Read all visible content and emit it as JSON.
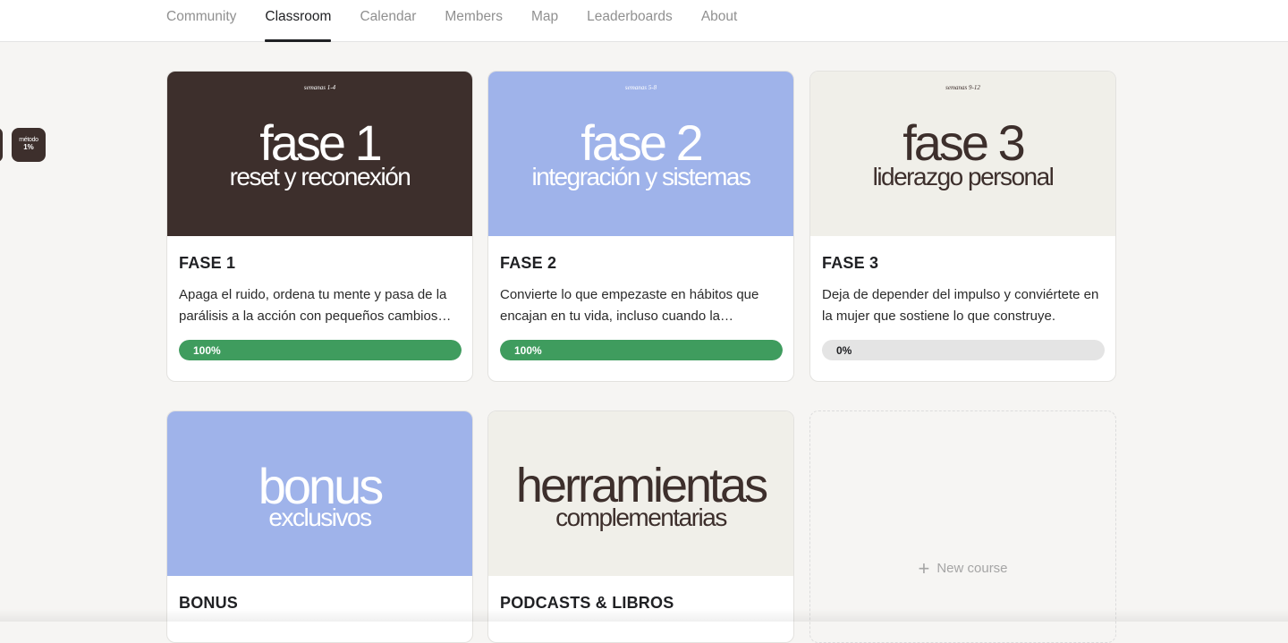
{
  "nav": {
    "tabs": [
      {
        "label": "Community",
        "active": false
      },
      {
        "label": "Classroom",
        "active": true
      },
      {
        "label": "Calendar",
        "active": false
      },
      {
        "label": "Members",
        "active": false
      },
      {
        "label": "Map",
        "active": false
      },
      {
        "label": "Leaderboards",
        "active": false
      },
      {
        "label": "About",
        "active": false
      }
    ]
  },
  "side_app": {
    "line1": "método",
    "line2": "1%"
  },
  "courses": [
    {
      "cover": {
        "weeks": "semanas 1-4",
        "big": "fase 1",
        "sub": "reset y reconexión",
        "bg": "#3d2f2c",
        "fg": "#ffffff"
      },
      "title": "FASE 1",
      "description": "Apaga el ruido, ordena tu mente y pasa de la parálisis a la acción con pequeños cambios…",
      "progress": 1.0,
      "progress_label": "100%"
    },
    {
      "cover": {
        "weeks": "semanas 5-8",
        "big": "fase 2",
        "sub": "integración y sistemas",
        "bg": "#9fb3ea",
        "fg": "#ffffff"
      },
      "title": "FASE 2",
      "description": "Convierte lo que empezaste en hábitos que encajan en tu vida, incluso cuando la…",
      "progress": 1.0,
      "progress_label": "100%"
    },
    {
      "cover": {
        "weeks": "semanas 9-12",
        "big": "fase 3",
        "sub": "liderazgo personal",
        "bg": "#f0efe9",
        "fg": "#3d2f2c"
      },
      "title": "FASE 3",
      "description": "Deja de depender del impulso y conviértete en la mujer que sostiene lo que construye.",
      "progress": 0.0,
      "progress_label": "0%"
    },
    {
      "cover": {
        "weeks": "",
        "big": "bonus",
        "sub": "exclusivos",
        "bg": "#9fb3ea",
        "fg": "#ffffff"
      },
      "title": "BONUS"
    },
    {
      "cover": {
        "weeks": "",
        "big": "herramientas",
        "sub": "complementarias",
        "bg": "#f0efe9",
        "fg": "#3d2f2c"
      },
      "title": "PODCASTS & LIBROS"
    }
  ],
  "new_course": {
    "icon": "plus-icon",
    "label": "New course"
  },
  "colors": {
    "progress_fill": "#3f9c5e",
    "progress_track": "#e4e4e4"
  }
}
